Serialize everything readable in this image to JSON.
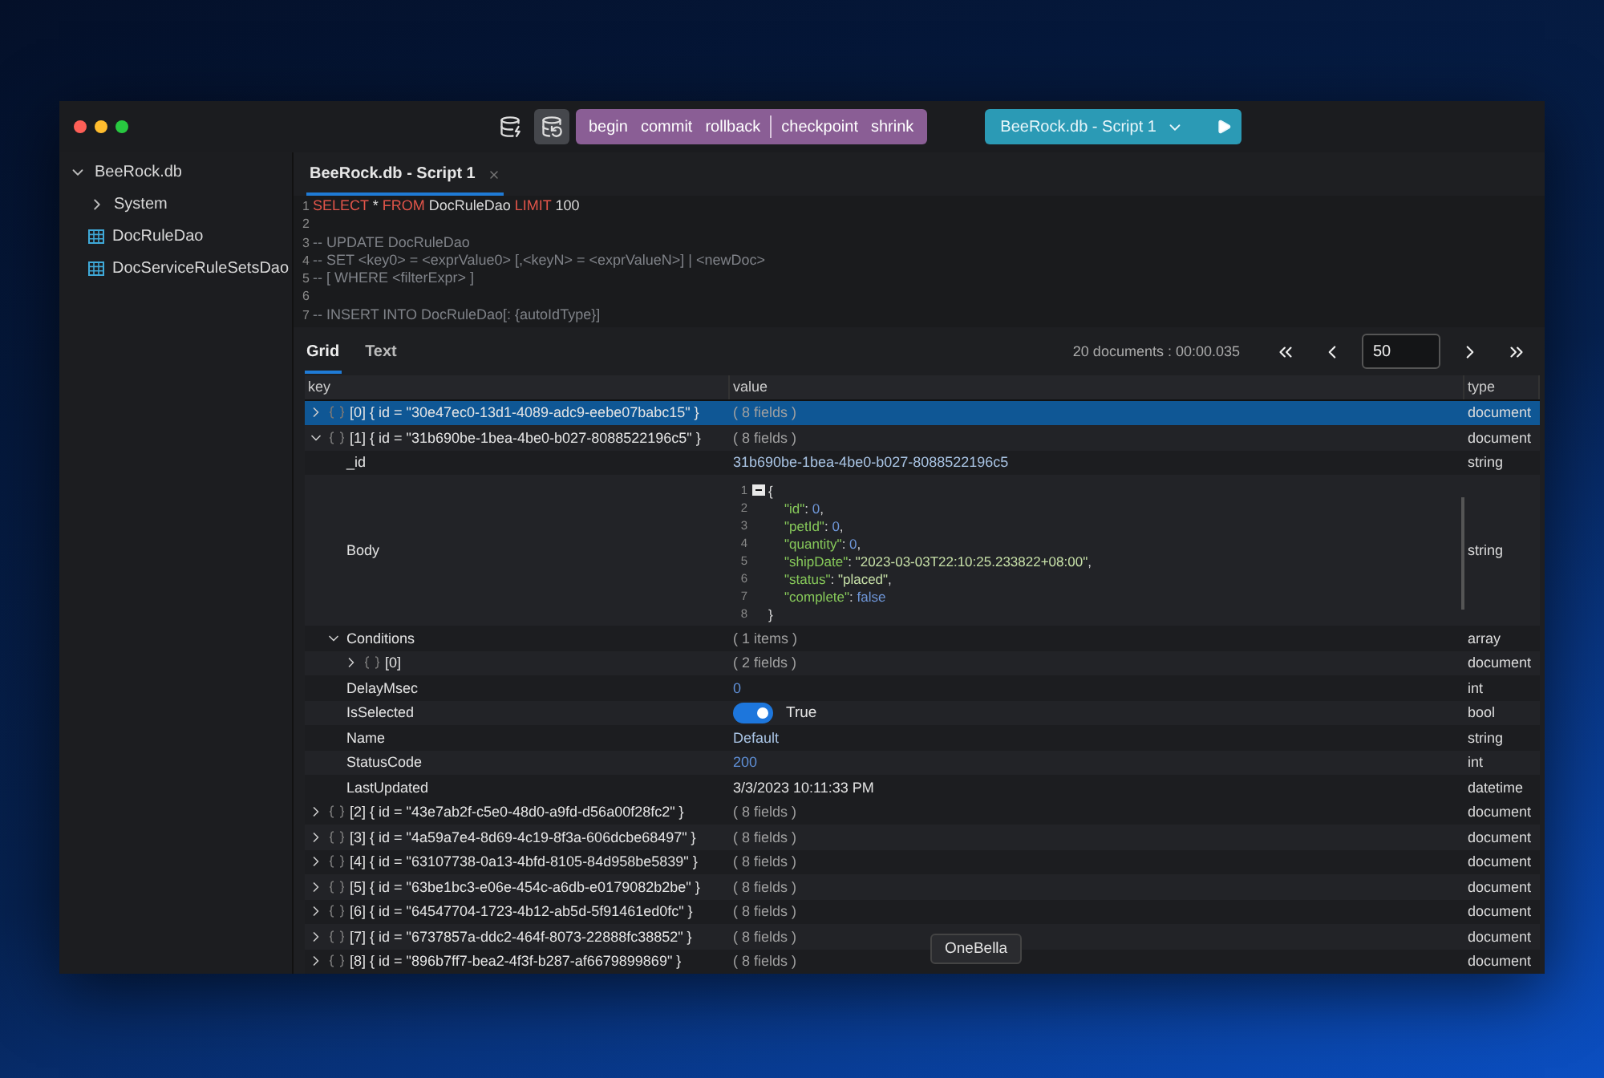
{
  "toolbar": {
    "transaction_buttons": [
      {
        "label": "begin",
        "separator_before": false
      },
      {
        "label": "commit",
        "separator_before": false
      },
      {
        "label": "rollback",
        "separator_before": false
      },
      {
        "label": "checkpoint",
        "separator_before": true
      },
      {
        "label": "shrink",
        "separator_before": false
      }
    ],
    "script_selector": "BeeRock.db - Script 1"
  },
  "sidebar": {
    "items": [
      {
        "label": "BeeRock.db",
        "expanded": true,
        "children": [
          {
            "label": "System",
            "expanded": false
          },
          {
            "label": "DocRuleDao",
            "kind": "table"
          },
          {
            "label": "DocServiceRuleSetsDao",
            "kind": "table"
          }
        ]
      }
    ]
  },
  "editor_tabs": [
    {
      "label": "BeeRock.db - Script 1",
      "selected": true
    }
  ],
  "code_lines": [
    {
      "n": "1",
      "parts": [
        {
          "t": "SELECT",
          "kind": "keyword"
        },
        {
          "t": " * ",
          "kind": "plain"
        },
        {
          "t": "FROM",
          "kind": "keyword"
        },
        {
          "t": " DocRuleDao ",
          "kind": "plain"
        },
        {
          "t": "LIMIT",
          "kind": "keyword"
        },
        {
          "t": " 100",
          "kind": "plain"
        }
      ]
    },
    {
      "n": "2"
    },
    {
      "n": "3",
      "parts": [
        {
          "t": "-- UPDATE DocRuleDao",
          "kind": "comment"
        }
      ]
    },
    {
      "n": "4",
      "parts": [
        {
          "t": "-- SET <key0> = <exprValue0> [,<keyN> = <exprValueN>] | <newDoc>",
          "kind": "comment"
        }
      ]
    },
    {
      "n": "5",
      "parts": [
        {
          "t": "-- [ WHERE <filterExpr> ]",
          "kind": "comment"
        }
      ]
    },
    {
      "n": "6"
    },
    {
      "n": "7",
      "parts": [
        {
          "t": "-- INSERT INTO DocRuleDao[: {autoIdType}]",
          "kind": "comment"
        }
      ]
    }
  ],
  "result_tabs": [
    {
      "label": "Grid",
      "selected": true
    },
    {
      "label": "Text",
      "selected": false
    }
  ],
  "summary": "20 documents : 00:00.035",
  "page_size": "50",
  "columns": [
    "key",
    "value",
    "type"
  ],
  "rows": [
    {
      "key": "[0] { id = \"30e47ec0-13d1-4089-adc9-eebe07babc15\" }",
      "value": {
        "kind": "count",
        "text": "( 8 fields )"
      },
      "type": "document",
      "kind": "document",
      "expanded": false,
      "selected": true
    },
    {
      "key": "[1] { id = \"31b690be-1bea-4be0-b027-8088522196c5\" }",
      "value": {
        "kind": "count",
        "text": "( 8 fields )"
      },
      "type": "document",
      "kind": "document",
      "expanded": true,
      "selected": false,
      "children": [
        {
          "key": "_id",
          "value": {
            "kind": "string",
            "text": "31b690be-1bea-4be0-b027-8088522196c5"
          },
          "type": "string"
        },
        {
          "key": "Body",
          "value": {
            "kind": "json",
            "lines": [
              {
                "n": "1",
                "parts": [
                  {
                    "t": "{",
                    "kind": "punct"
                  }
                ]
              },
              {
                "n": "2",
                "parts": [
                  {
                    "t": "\"id\"",
                    "kind": "key"
                  },
                  {
                    "t": ": ",
                    "kind": "punct"
                  },
                  {
                    "t": "0",
                    "kind": "number"
                  },
                  {
                    "t": ",",
                    "kind": "punct"
                  }
                ]
              },
              {
                "n": "3",
                "parts": [
                  {
                    "t": "\"petId\"",
                    "kind": "key"
                  },
                  {
                    "t": ": ",
                    "kind": "punct"
                  },
                  {
                    "t": "0",
                    "kind": "number"
                  },
                  {
                    "t": ",",
                    "kind": "punct"
                  }
                ]
              },
              {
                "n": "4",
                "parts": [
                  {
                    "t": "\"quantity\"",
                    "kind": "key"
                  },
                  {
                    "t": ": ",
                    "kind": "punct"
                  },
                  {
                    "t": "0",
                    "kind": "number"
                  },
                  {
                    "t": ",",
                    "kind": "punct"
                  }
                ]
              },
              {
                "n": "5",
                "parts": [
                  {
                    "t": "\"shipDate\"",
                    "kind": "key"
                  },
                  {
                    "t": ": ",
                    "kind": "punct"
                  },
                  {
                    "t": "\"2023-03-03T22:10:25.233822+08:00\"",
                    "kind": "string"
                  },
                  {
                    "t": ",",
                    "kind": "punct"
                  }
                ]
              },
              {
                "n": "6",
                "parts": [
                  {
                    "t": "\"status\"",
                    "kind": "key"
                  },
                  {
                    "t": ": ",
                    "kind": "punct"
                  },
                  {
                    "t": "\"placed\"",
                    "kind": "string"
                  },
                  {
                    "t": ",",
                    "kind": "punct"
                  }
                ]
              },
              {
                "n": "7",
                "parts": [
                  {
                    "t": "\"complete\"",
                    "kind": "key"
                  },
                  {
                    "t": ": ",
                    "kind": "punct"
                  },
                  {
                    "t": "false",
                    "kind": "number"
                  }
                ]
              },
              {
                "n": "8",
                "parts": [
                  {
                    "t": "}",
                    "kind": "punct"
                  }
                ]
              }
            ]
          },
          "type": "string"
        },
        {
          "key": "Conditions",
          "value": {
            "kind": "count",
            "text": "( 1 items )"
          },
          "type": "array",
          "expanded": true,
          "children": [
            {
              "key": "[0]",
              "value": {
                "kind": "count",
                "text": "( 2 fields )"
              },
              "type": "document",
              "kind": "document",
              "expanded": false
            }
          ]
        },
        {
          "key": "DelayMsec",
          "value": {
            "kind": "number",
            "text": "0"
          },
          "type": "int"
        },
        {
          "key": "IsSelected",
          "value": {
            "kind": "toggle",
            "text": "True",
            "on": true
          },
          "type": "bool"
        },
        {
          "key": "Name",
          "value": {
            "kind": "string",
            "text": "Default"
          },
          "type": "string"
        },
        {
          "key": "StatusCode",
          "value": {
            "kind": "number",
            "text": "200"
          },
          "type": "int"
        },
        {
          "key": "LastUpdated",
          "value": {
            "kind": "date",
            "text": "3/3/2023 10:11:33 PM"
          },
          "type": "datetime"
        }
      ]
    },
    {
      "key": "[2] { id = \"43e7ab2f-c5e0-48d0-a9fd-d56a00f28fc2\" }",
      "value": {
        "kind": "count",
        "text": "( 8 fields )"
      },
      "type": "document",
      "kind": "document",
      "expanded": false,
      "selected": false
    },
    {
      "key": "[3] { id = \"4a59a7e4-8d69-4c19-8f3a-606dcbe68497\" }",
      "value": {
        "kind": "count",
        "text": "( 8 fields )"
      },
      "type": "document",
      "kind": "document",
      "expanded": false,
      "selected": false
    },
    {
      "key": "[4] { id = \"63107738-0a13-4bfd-8105-84d958be5839\" }",
      "value": {
        "kind": "count",
        "text": "( 8 fields )"
      },
      "type": "document",
      "kind": "document",
      "expanded": false,
      "selected": false
    },
    {
      "key": "[5] { id = \"63be1bc3-e06e-454c-a6db-e0179082b2be\" }",
      "value": {
        "kind": "count",
        "text": "( 8 fields )"
      },
      "type": "document",
      "kind": "document",
      "expanded": false,
      "selected": false
    },
    {
      "key": "[6] { id = \"64547704-1723-4b12-ab5d-5f91461ed0fc\" }",
      "value": {
        "kind": "count",
        "text": "( 8 fields )"
      },
      "type": "document",
      "kind": "document",
      "expanded": false,
      "selected": false
    },
    {
      "key": "[7] { id = \"6737857a-ddc2-464f-8073-22888fc38852\" }",
      "value": {
        "kind": "count",
        "text": "( 8 fields )"
      },
      "type": "document",
      "kind": "document",
      "expanded": false,
      "selected": false
    },
    {
      "key": "[8] { id = \"896b7ff7-bea2-4f3f-b287-af6679899869\" }",
      "value": {
        "kind": "count",
        "text": "( 8 fields )"
      },
      "type": "document",
      "kind": "document",
      "expanded": false,
      "selected": false
    }
  ],
  "tooltip": "OneBella"
}
